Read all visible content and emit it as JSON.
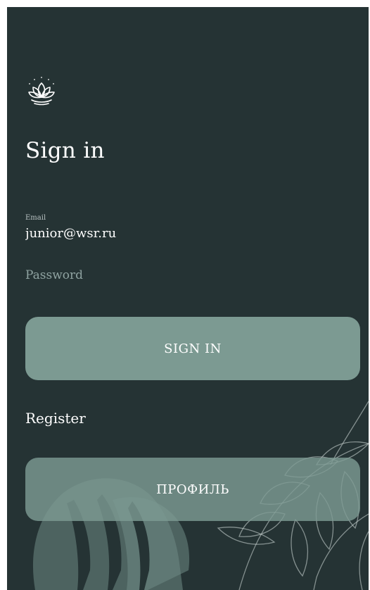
{
  "app": {
    "background_color": "#253334",
    "accent_color": "#7C9A92",
    "logo_icon": "lotus-icon"
  },
  "screen": {
    "title": "Sign in"
  },
  "form": {
    "email_label": "Email",
    "email_value": "junior@wsr.ru",
    "password_placeholder": "Password",
    "password_value": ""
  },
  "actions": {
    "signin_label": "SIGN IN",
    "register_label": "Register",
    "profile_label": "ПРОФИЛЬ"
  },
  "decor": {
    "leaves_icon": "leaves-decoration"
  }
}
